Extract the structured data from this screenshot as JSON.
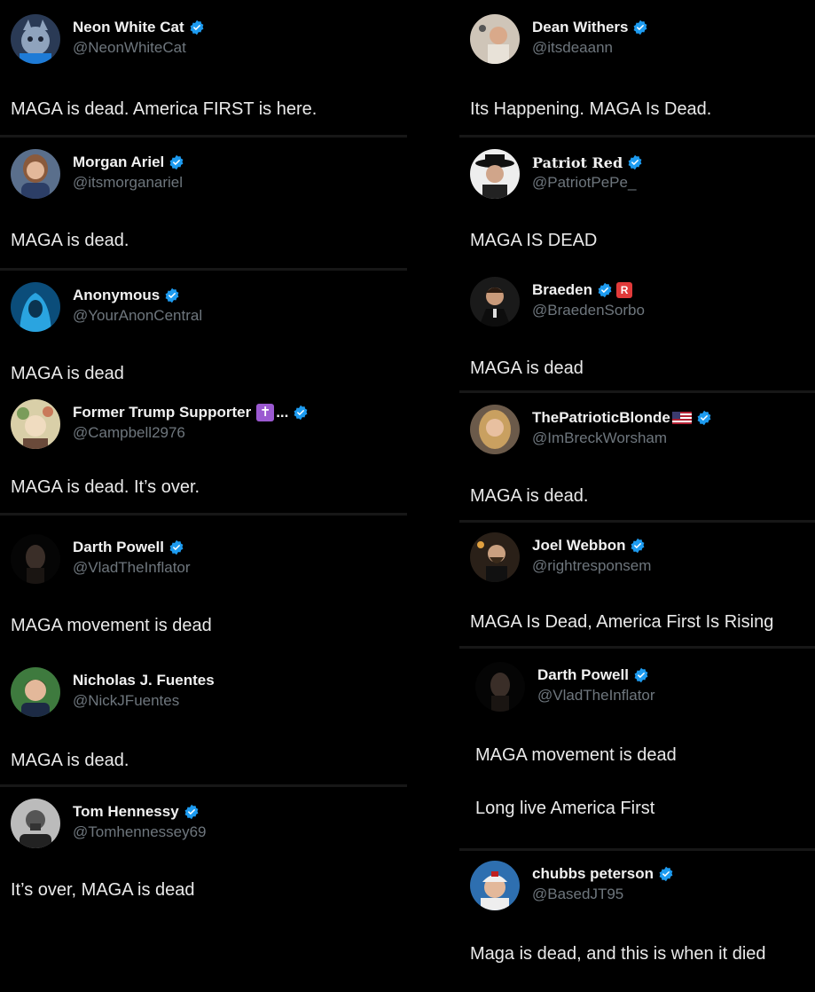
{
  "left": [
    {
      "name": "Neon White Cat",
      "handle": "@NeonWhiteCat",
      "text": "MAGA is dead. America FIRST is here.",
      "avatar": "cat-avatar"
    },
    {
      "name": "Morgan Ariel",
      "handle": "@itsmorganariel",
      "text": "MAGA is dead.",
      "avatar": "woman-avatar"
    },
    {
      "name": "Anonymous",
      "handle": "@YourAnonCentral",
      "text": "MAGA is dead",
      "avatar": "hooded-figure-avatar"
    },
    {
      "name": "Former Trump Supporter",
      "name_suffix": "...",
      "emoji": "✝",
      "handle": "@Campbell2976",
      "text": "MAGA is dead. It’s over.",
      "avatar": "painting-avatar"
    },
    {
      "name": "Darth Powell",
      "handle": "@VladTheInflator",
      "text": "MAGA movement is dead",
      "avatar": "dark-face-avatar"
    },
    {
      "name": "Nicholas J. Fuentes",
      "handle": "@NickJFuentes",
      "text": "MAGA is dead.",
      "avatar": "man-avatar"
    },
    {
      "name": "Tom Hennessy",
      "handle": "@Tomhennessey69",
      "text": "It’s over, MAGA is dead",
      "avatar": "bw-man-avatar"
    }
  ],
  "right": [
    {
      "name": "Dean Withers",
      "handle": "@itsdeaann",
      "text": "Its Happening. MAGA Is Dead.",
      "avatar": "man-mirror-avatar"
    },
    {
      "name": "Patriot Red",
      "handle": "@PatriotPePe_",
      "text": "MAGA IS DEAD",
      "avatar": "cowboy-avatar"
    },
    {
      "name": "Braeden",
      "handle": "@BraedenSorbo",
      "text": "MAGA is dead",
      "badge": "R",
      "avatar": "suit-man-avatar"
    },
    {
      "name": "ThePatrioticBlonde",
      "handle": "@ImBreckWorsham",
      "text": "MAGA is dead.",
      "avatar": "blonde-avatar"
    },
    {
      "name": "Joel Webbon",
      "handle": "@rightresponsem",
      "text": "MAGA Is Dead, America First Is Rising",
      "avatar": "bearded-man-avatar"
    },
    {
      "name": "Darth Powell",
      "handle": "@VladTheInflator",
      "text": "MAGA movement is dead",
      "text2": "Long live America First",
      "avatar": "dark-face-avatar"
    },
    {
      "name": "chubbs peterson",
      "handle": "@BasedJT95",
      "text": "Maga is dead, and this is when it died",
      "avatar": "cap-man-avatar"
    }
  ],
  "colors": {
    "background": "#000000",
    "verified": "#1d9bf0",
    "handle": "#6e767d",
    "divider": "#171717"
  }
}
